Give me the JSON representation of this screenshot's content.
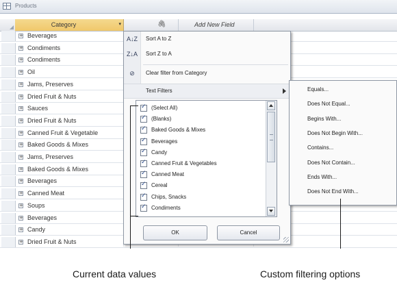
{
  "tab": {
    "title": "Products"
  },
  "header": {
    "category_label": "Category",
    "add_field_label": "Add New Field",
    "dropdown_glyph": "▾",
    "attachment_glyph": "🖇"
  },
  "rows": [
    "Beverages",
    "Condiments",
    "Condiments",
    "Oil",
    "Jams, Preserves",
    "Dried Fruit & Nuts",
    "Sauces",
    "Dried Fruit & Nuts",
    "Canned Fruit & Vegetable",
    "Baked Goods & Mixes",
    "Jams, Preserves",
    "Baked Goods & Mixes",
    "Beverages",
    "Canned Meat",
    "Soups",
    "Beverages",
    "Candy",
    "Dried Fruit & Nuts"
  ],
  "menu": {
    "sort_az": {
      "icon": "A↓Z",
      "label": "Sort A to Z"
    },
    "sort_za": {
      "icon": "Z↓A",
      "label": "Sort Z to A"
    },
    "clear_filter": {
      "icon": "⊘",
      "label": "Clear filter from Category"
    },
    "text_filters": "Text Filters",
    "values": [
      "(Select All)",
      "(Blanks)",
      "Baked Goods & Mixes",
      "Beverages",
      "Candy",
      "Canned Fruit & Vegetables",
      "Canned Meat",
      "Cereal",
      "Chips, Snacks",
      "Condiments"
    ],
    "ok": "OK",
    "cancel": "Cancel"
  },
  "submenu": [
    "Equals...",
    "Does Not Equal...",
    "Begins With...",
    "Does Not Begin With...",
    "Contains...",
    "Does Not Contain...",
    "Ends With...",
    "Does Not End With..."
  ],
  "captions": {
    "left": "Current data values",
    "right": "Custom filtering options"
  },
  "colors": {
    "header_accent": "#f0c86b",
    "menu_border": "#8e97a4"
  }
}
